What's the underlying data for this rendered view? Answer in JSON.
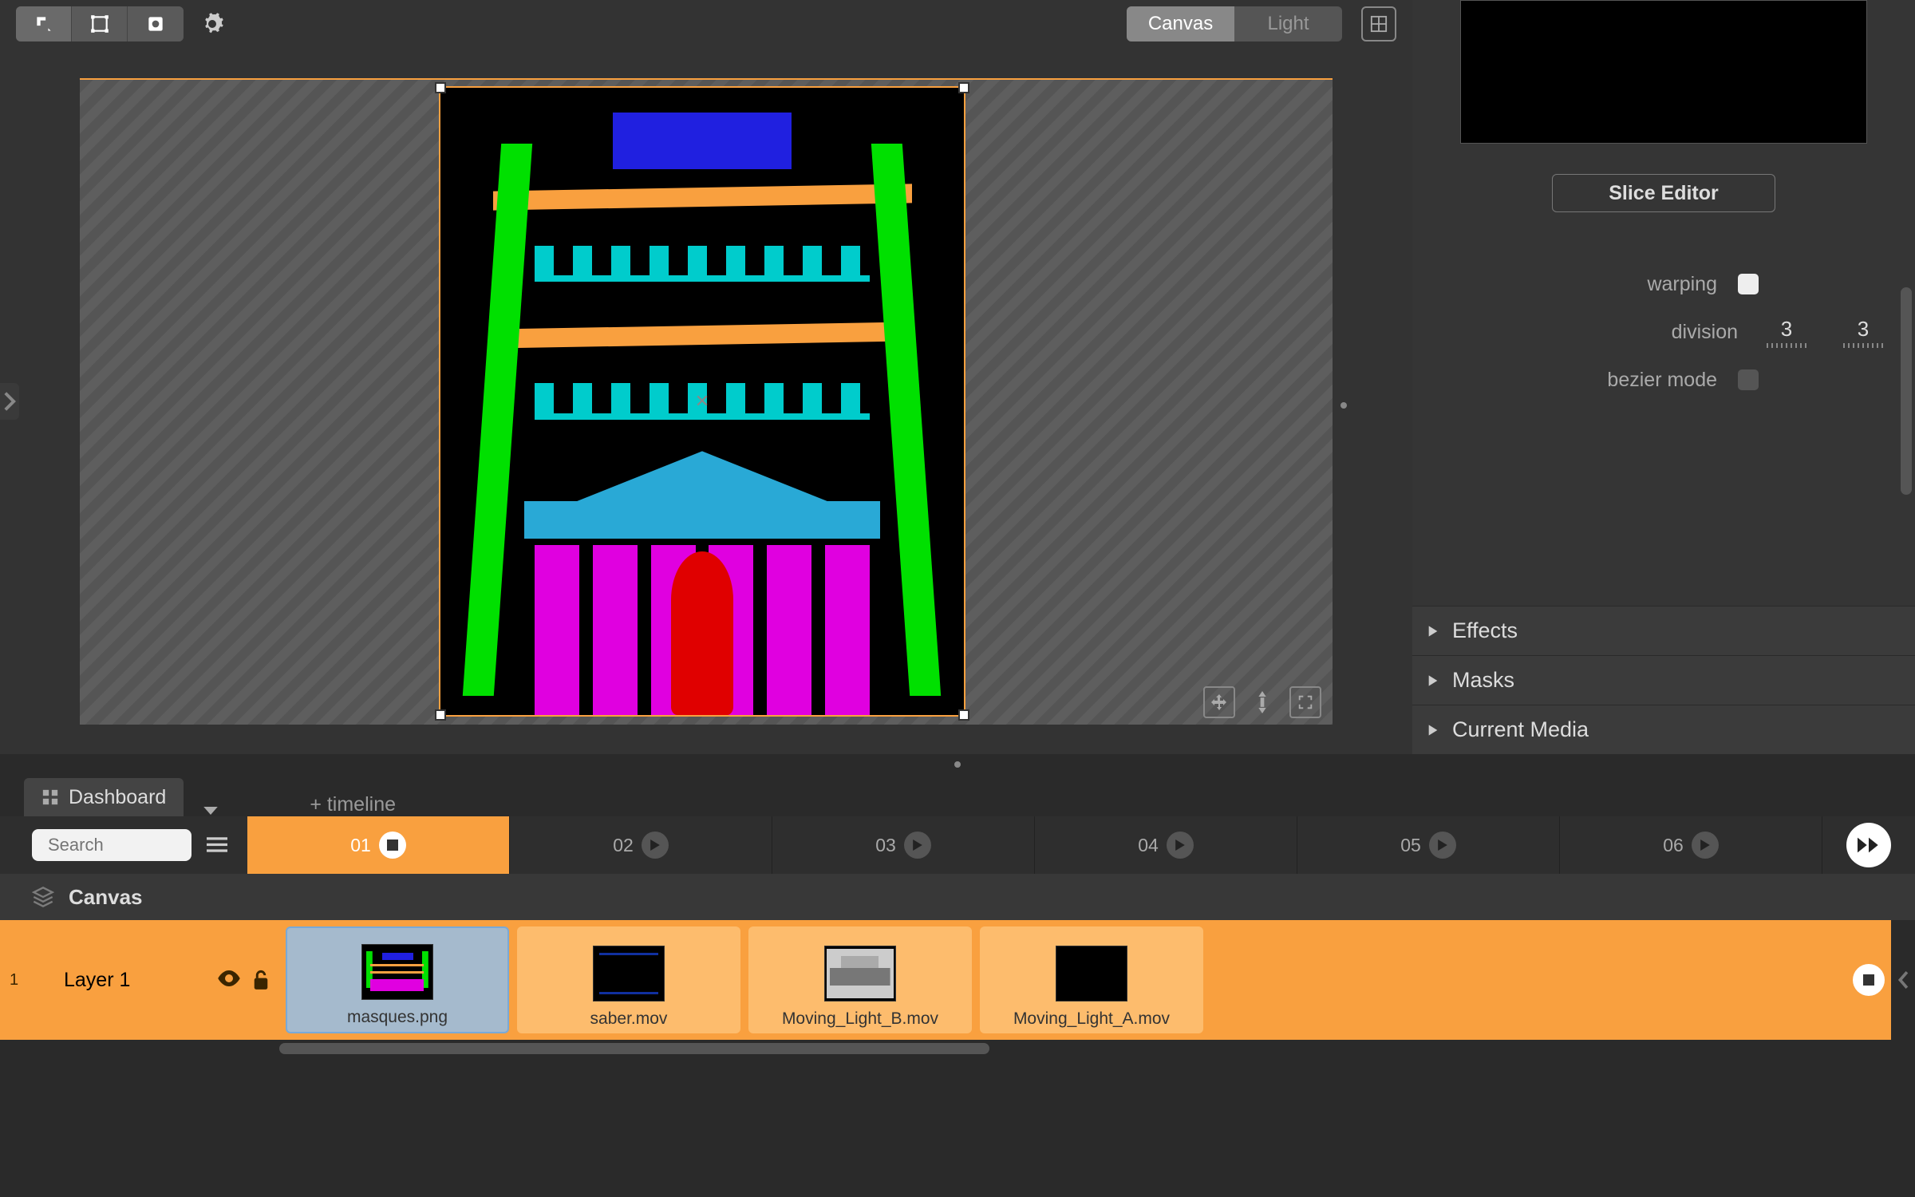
{
  "toolbar": {
    "view_tabs": {
      "canvas": "Canvas",
      "light": "Light"
    }
  },
  "side": {
    "slice_editor": "Slice Editor",
    "props": {
      "warping_label": "warping",
      "division_label": "division",
      "division_x": "3",
      "division_y": "3",
      "bezier_label": "bezier mode"
    },
    "accordion": {
      "effects": "Effects",
      "masks": "Masks",
      "current_media": "Current Media"
    }
  },
  "tabs": {
    "dashboard": "Dashboard",
    "add_timeline": "+ timeline"
  },
  "timeline": {
    "search_placeholder": "Search",
    "columns": [
      "01",
      "02",
      "03",
      "04",
      "05",
      "06"
    ],
    "canvas_label": "Canvas",
    "layer": {
      "index": "1",
      "name": "Layer 1"
    },
    "clips": [
      {
        "name": "masques.png",
        "selected": true
      },
      {
        "name": "saber.mov",
        "selected": false
      },
      {
        "name": "Moving_Light_B.mov",
        "selected": false
      },
      {
        "name": "Moving_Light_A.mov",
        "selected": false
      }
    ]
  }
}
